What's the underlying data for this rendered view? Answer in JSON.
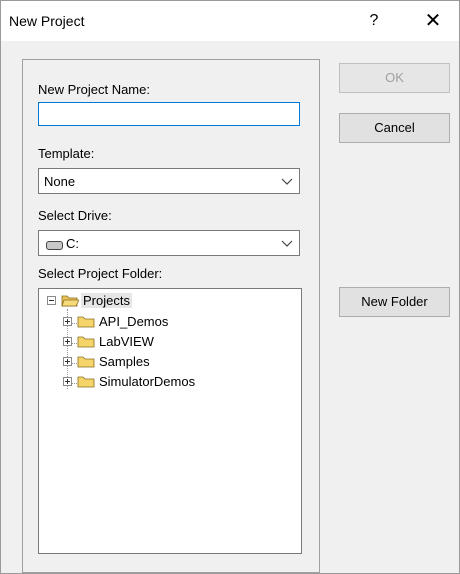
{
  "window": {
    "title": "New Project",
    "help_label": "?",
    "close_label": "✕"
  },
  "project_name": {
    "label": "New Project Name:",
    "value": ""
  },
  "template": {
    "label": "Template:",
    "selected": "None"
  },
  "drive": {
    "label": "Select Drive:",
    "selected": "C:",
    "icon": "drive-icon"
  },
  "folder": {
    "label": "Select Project Folder:",
    "root": {
      "label": "Projects",
      "expanded": true,
      "icon": "folder-open-icon"
    },
    "children": [
      {
        "label": "API_Demos",
        "icon": "folder-icon"
      },
      {
        "label": "LabVIEW",
        "icon": "folder-icon"
      },
      {
        "label": "Samples",
        "icon": "folder-icon"
      },
      {
        "label": "SimulatorDemos",
        "icon": "folder-icon"
      }
    ]
  },
  "buttons": {
    "ok": "OK",
    "cancel": "Cancel",
    "new_folder": "New Folder"
  },
  "colors": {
    "focus_border": "#0078d7",
    "folder_fill": "#f5d46a",
    "disabled_text": "#a0a0a0"
  }
}
